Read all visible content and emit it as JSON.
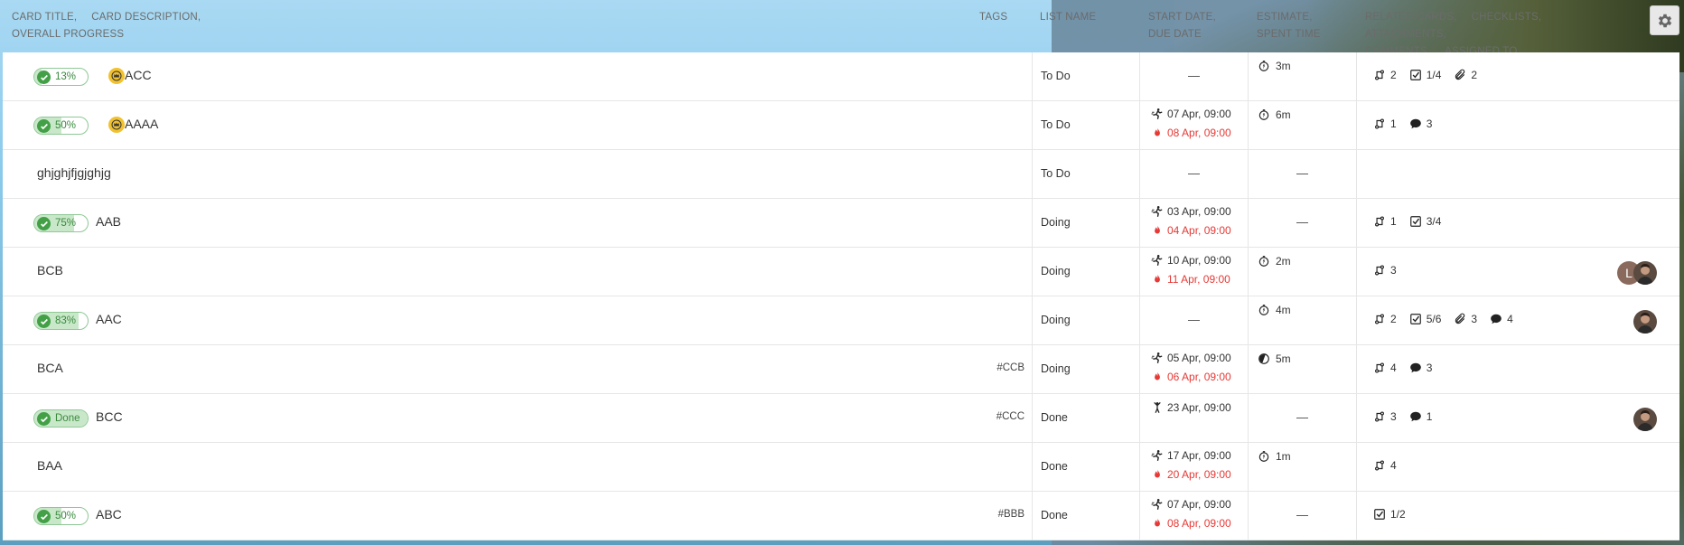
{
  "header": {
    "title_col": [
      "CARD TITLE,",
      "CARD DESCRIPTION,",
      "OVERALL PROGRESS"
    ],
    "tags_col": "TAGS",
    "list_col": "LIST NAME",
    "dates_col": [
      "START DATE,",
      "DUE DATE"
    ],
    "estimate_col": [
      "ESTIMATE,",
      "SPENT TIME"
    ],
    "related_col": [
      "RELATED CARDS,",
      "CHECKLISTS,",
      "ATTACHMENTS,",
      "COMMENTS,",
      "ASSIGNED TO"
    ]
  },
  "rows": [
    {
      "progress": "13%",
      "progress_value": 0.13,
      "crown": true,
      "title": "ACC",
      "tag": "",
      "list": "To Do",
      "start": "",
      "due": "",
      "estimate": "3m",
      "est_icon": "stopwatch-icon",
      "related": "2",
      "checklist": "1/4",
      "attachments": "2",
      "comments": "",
      "avatars": []
    },
    {
      "progress": "50%",
      "progress_value": 0.5,
      "crown": true,
      "title": "AAAA",
      "tag": "",
      "list": "To Do",
      "start": "07 Apr, 09:00",
      "due": "08 Apr, 09:00",
      "estimate": "6m",
      "est_icon": "stopwatch-icon",
      "related": "1",
      "checklist": "",
      "attachments": "",
      "comments": "3",
      "avatars": []
    },
    {
      "progress": "",
      "progress_value": null,
      "crown": false,
      "title": "ghjghjfjgjghjg",
      "tag": "",
      "list": "To Do",
      "start": "",
      "due": "",
      "estimate": "",
      "est_icon": "",
      "related": "",
      "checklist": "",
      "attachments": "",
      "comments": "",
      "avatars": []
    },
    {
      "progress": "75%",
      "progress_value": 0.75,
      "crown": false,
      "title": "AAB",
      "tag": "",
      "list": "Doing",
      "start": "03 Apr, 09:00",
      "due": "04 Apr, 09:00",
      "estimate": "",
      "est_icon": "",
      "related": "1",
      "checklist": "3/4",
      "attachments": "",
      "comments": "",
      "avatars": []
    },
    {
      "progress": "",
      "progress_value": null,
      "crown": false,
      "title": "BCB",
      "tag": "",
      "list": "Doing",
      "start": "10 Apr, 09:00",
      "due": "11 Apr, 09:00",
      "estimate": "2m",
      "est_icon": "stopwatch-icon",
      "related": "3",
      "checklist": "",
      "attachments": "",
      "comments": "",
      "avatars": [
        "L",
        "photo"
      ]
    },
    {
      "progress": "83%",
      "progress_value": 0.83,
      "crown": false,
      "title": "AAC",
      "tag": "",
      "list": "Doing",
      "start": "",
      "due": "",
      "estimate": "4m",
      "est_icon": "stopwatch-icon",
      "related": "2",
      "checklist": "5/6",
      "attachments": "3",
      "comments": "4",
      "avatars": [
        "photo"
      ]
    },
    {
      "progress": "",
      "progress_value": null,
      "crown": false,
      "title": "BCA",
      "tag": "#CCB",
      "list": "Doing",
      "start": "05 Apr, 09:00",
      "due": "06 Apr, 09:00",
      "estimate": "5m",
      "est_icon": "timer-running-icon",
      "related": "4",
      "checklist": "",
      "attachments": "",
      "comments": "3",
      "avatars": []
    },
    {
      "progress": "Done",
      "progress_value": 1,
      "crown": false,
      "title": "BCC",
      "tag": "#CCC",
      "list": "Done",
      "start": "23 Apr, 09:00",
      "due": "",
      "estimate": "",
      "est_icon": "",
      "related": "3",
      "checklist": "",
      "attachments": "",
      "comments": "1",
      "avatars": [
        "photo"
      ]
    },
    {
      "progress": "",
      "progress_value": null,
      "crown": false,
      "title": "BAA",
      "tag": "",
      "list": "Done",
      "start": "17 Apr, 09:00",
      "due": "20 Apr, 09:00",
      "estimate": "1m",
      "est_icon": "stopwatch-icon",
      "related": "4",
      "checklist": "",
      "attachments": "",
      "comments": "",
      "avatars": []
    },
    {
      "progress": "50%",
      "progress_value": 0.5,
      "crown": false,
      "title": "ABC",
      "tag": "#BBB",
      "list": "Done",
      "start": "07 Apr, 09:00",
      "due": "08 Apr, 09:00",
      "estimate": "",
      "est_icon": "",
      "related": "",
      "checklist": "1/2",
      "attachments": "",
      "comments": "",
      "avatars": []
    }
  ],
  "placeholder_dash": "—",
  "colors": {
    "progress_green": "#43a047",
    "due_red": "#e53935",
    "crown_yellow": "#f2c12e"
  }
}
